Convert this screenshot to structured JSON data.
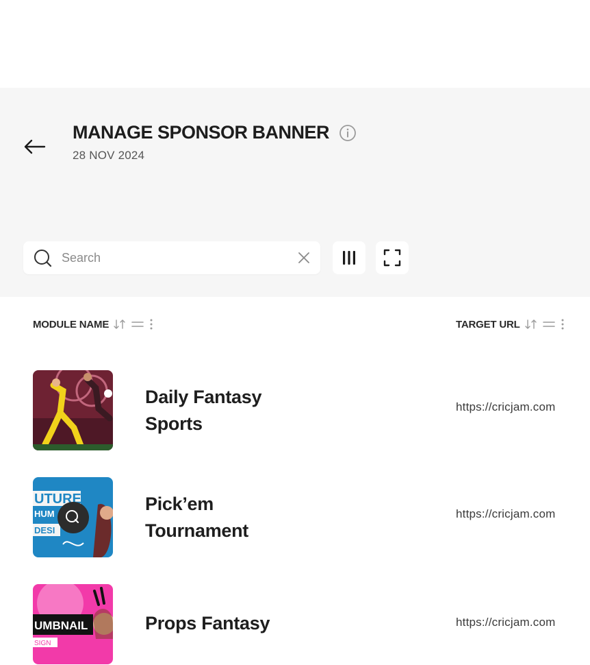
{
  "header": {
    "title": "MANAGE SPONSOR BANNER",
    "date": "28 NOV 2024",
    "icons": {
      "back": "arrow-left-icon",
      "info": "info-circle-icon"
    }
  },
  "toolbar": {
    "search_placeholder": "Search",
    "search_value": "",
    "icons": {
      "search": "search-icon",
      "clear": "close-icon",
      "columns": "columns-icon",
      "fullscreen": "fullscreen-icon"
    }
  },
  "table": {
    "columns": [
      {
        "label": "MODULE NAME"
      },
      {
        "label": "TARGET URL"
      }
    ],
    "rows": [
      {
        "name": "Daily Fantasy Sports",
        "url": "https://cricjam.com",
        "thumb_color": "#7a2a3a"
      },
      {
        "name": "Pick’em Tournament",
        "url": "https://cricjam.com",
        "thumb_color": "#1d86c2"
      },
      {
        "name": "Props Fantasy",
        "url": "https://cricjam.com",
        "thumb_color": "#f23aa9"
      }
    ],
    "thumb_text": {
      "row2": [
        "UTURE",
        "HUM",
        "DESI"
      ],
      "row3": [
        "UMBNAIL",
        "SIGN"
      ]
    }
  }
}
